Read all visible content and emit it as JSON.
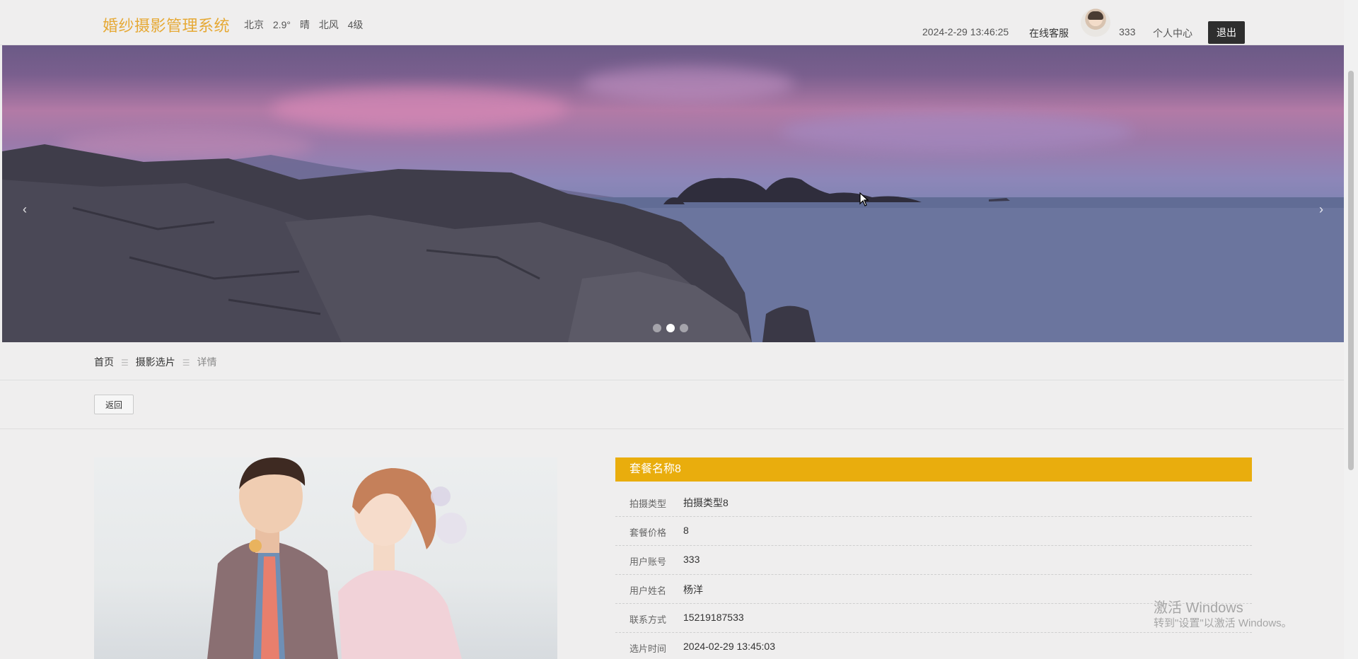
{
  "header": {
    "logo": "婚纱摄影管理系统",
    "weather": {
      "city": "北京",
      "temperature": "2.9°",
      "condition": "晴",
      "wind": "北风",
      "level": "4级"
    },
    "datetime": "2024-2-29 13:46:25",
    "service": "在线客服",
    "username": "333",
    "profile": "个人中心",
    "logout": "退出"
  },
  "banner": {
    "prev": "‹",
    "next": "›",
    "slide_count": 3,
    "active_slide": 2
  },
  "breadcrumb": {
    "home": "首页",
    "sep": "☰",
    "section": "摄影选片",
    "current": "详情"
  },
  "back_button": "返回",
  "detail": {
    "title": "套餐名称8",
    "fields": [
      {
        "label": "拍摄类型",
        "value": "拍摄类型8"
      },
      {
        "label": "套餐价格",
        "value": "8"
      },
      {
        "label": "用户账号",
        "value": "333"
      },
      {
        "label": "用户姓名",
        "value": "杨洋"
      },
      {
        "label": "联系方式",
        "value": "15219187533"
      },
      {
        "label": "选片时间",
        "value": "2024-02-29 13:45:03"
      }
    ]
  },
  "watermark": {
    "line1": "激活 Windows",
    "line2": "转到\"设置\"以激活 Windows。"
  },
  "colors": {
    "accent": "#e9ad0d",
    "logo": "#e6a935",
    "logout_bg": "#2e2e2e"
  }
}
